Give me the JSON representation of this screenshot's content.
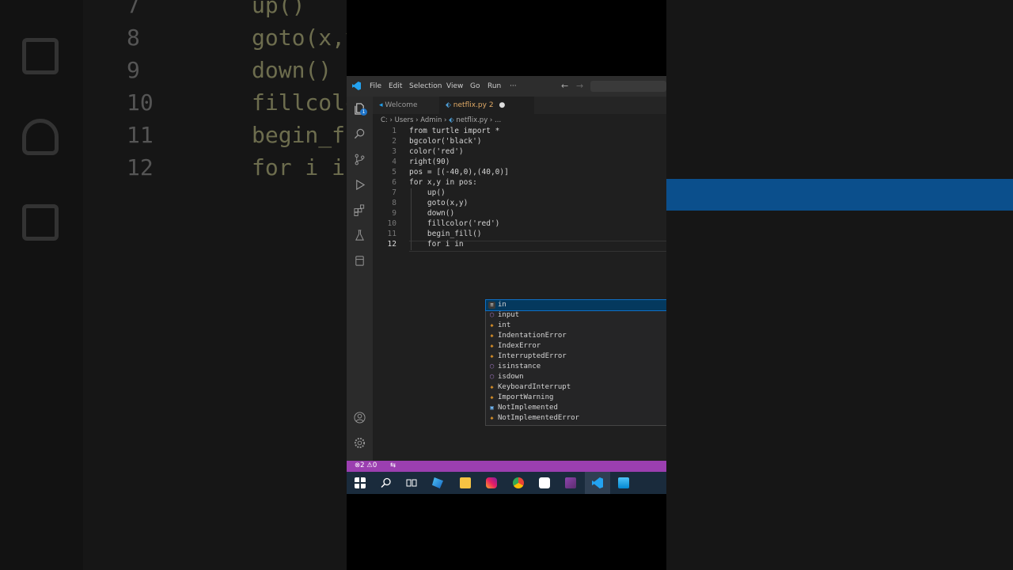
{
  "menu": [
    "File",
    "Edit",
    "Selection",
    "View",
    "Go",
    "Run",
    "···"
  ],
  "tabs": [
    {
      "label": "Welcome"
    },
    {
      "label": "netflix.py",
      "badge": "2"
    }
  ],
  "breadcrumb": {
    "path": [
      "C:",
      "Users",
      "Admin",
      "netflix.py",
      "..."
    ]
  },
  "activity_badge": "1",
  "code_lines": [
    "from turtle import *",
    "bgcolor('black')",
    "color('red')",
    "right(90)",
    "pos = [(-40,0),(40,0)]",
    "for x,y in pos:",
    "    up()",
    "    goto(x,y)",
    "    down()",
    "    fillcolor('red')",
    "    begin_fill()",
    "    for i in"
  ],
  "line_numbers": [
    "1",
    "2",
    "3",
    "4",
    "5",
    "6",
    "7",
    "8",
    "9",
    "10",
    "11",
    "12"
  ],
  "suggestions": [
    {
      "label": "in",
      "kind": "keyword"
    },
    {
      "label": "input",
      "kind": "function"
    },
    {
      "label": "int",
      "kind": "class"
    },
    {
      "label": "IndentationError",
      "kind": "class"
    },
    {
      "label": "IndexError",
      "kind": "class"
    },
    {
      "label": "InterruptedError",
      "kind": "class"
    },
    {
      "label": "isinstance",
      "kind": "function"
    },
    {
      "label": "isdown",
      "kind": "function"
    },
    {
      "label": "KeyboardInterrupt",
      "kind": "class"
    },
    {
      "label": "ImportWarning",
      "kind": "class"
    },
    {
      "label": "NotImplemented",
      "kind": "variable"
    },
    {
      "label": "NotImplementedError",
      "kind": "class"
    }
  ],
  "status": {
    "errors": "2",
    "warnings": "0"
  },
  "background": {
    "left_numbers": [
      "7",
      "8",
      "9",
      "10",
      "11",
      "12"
    ],
    "left_code": [
      "up()",
      "goto(x,y",
      "down() ",
      "fillcolo",
      "begin_f",
      "for i i"
    ]
  },
  "colors": {
    "status_bar": "#9b3fb0",
    "accent": "#23a2f0",
    "selection": "#04395e"
  }
}
